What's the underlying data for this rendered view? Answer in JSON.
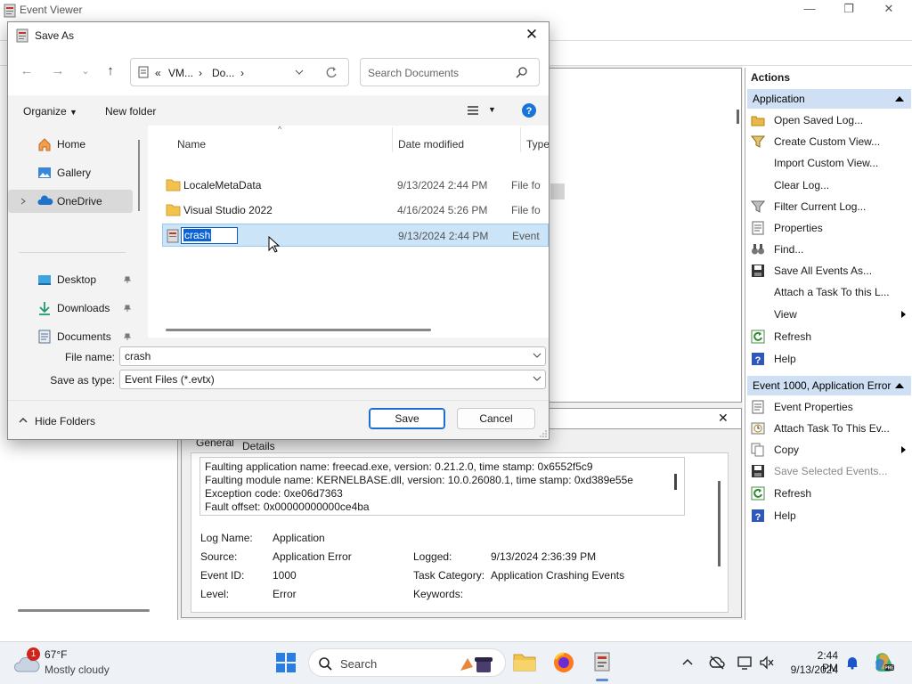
{
  "event_viewer": {
    "title": "Event Viewer",
    "controls": {
      "minimize": "—",
      "maximize": "❐",
      "close": "✕"
    },
    "detail": {
      "tabs": [
        "General",
        "Details"
      ],
      "description": [
        "Faulting application name: freecad.exe, version: 0.21.2.0, time stamp: 0x6552f5c9",
        "Faulting module name: KERNELBASE.dll, version: 10.0.26080.1, time stamp: 0xd389e55e",
        "Exception code: 0xe06d7363",
        "Fault offset: 0x00000000000ce4ba"
      ],
      "fields": {
        "log_name_label": "Log Name:",
        "log_name": "Application",
        "source_label": "Source:",
        "source": "Application Error",
        "logged_label": "Logged:",
        "logged": "9/13/2024 2:36:39 PM",
        "event_id_label": "Event ID:",
        "event_id": "1000",
        "task_category_label": "Task Category:",
        "task_category": "Application Crashing Events",
        "level_label": "Level:",
        "level": "Error",
        "keywords_label": "Keywords:"
      }
    }
  },
  "actions": {
    "header": "Actions",
    "section1": "Application",
    "items1": [
      {
        "label": "Open Saved Log...",
        "icon": "folder-open-icon"
      },
      {
        "label": "Create Custom View...",
        "icon": "filter-icon"
      },
      {
        "label": "Import Custom View...",
        "icon": ""
      },
      {
        "label": "Clear Log...",
        "icon": ""
      },
      {
        "label": "Filter Current Log...",
        "icon": "filter-icon"
      },
      {
        "label": "Properties",
        "icon": "properties-icon"
      },
      {
        "label": "Find...",
        "icon": "binoculars-icon"
      },
      {
        "label": "Save All Events As...",
        "icon": "save-icon"
      },
      {
        "label": "Attach a Task To this L...",
        "icon": ""
      },
      {
        "label": "View",
        "icon": ""
      },
      {
        "label": "Refresh",
        "icon": "refresh-icon"
      },
      {
        "label": "Help",
        "icon": "help-icon"
      }
    ],
    "section2": "Event 1000, Application Error",
    "items2": [
      {
        "label": "Event Properties",
        "icon": "properties-icon"
      },
      {
        "label": "Attach Task To This Ev...",
        "icon": "task-icon"
      },
      {
        "label": "Copy",
        "icon": "copy-icon"
      },
      {
        "label": "Save Selected Events...",
        "icon": "save-icon"
      },
      {
        "label": "Refresh",
        "icon": "refresh-icon"
      },
      {
        "label": "Help",
        "icon": "help-icon"
      }
    ]
  },
  "dialog": {
    "title": "Save As",
    "close": "✕",
    "breadcrumb": {
      "prefix": "«",
      "c1": "VM...",
      "sep1": "›",
      "c2": "Do...",
      "sep2": "›"
    },
    "search_placeholder": "Search Documents",
    "organize": "Organize",
    "new_folder": "New folder",
    "sidebar": [
      {
        "label": "Home",
        "icon": "home-icon"
      },
      {
        "label": "Gallery",
        "icon": "gallery-icon"
      },
      {
        "label": "OneDrive",
        "icon": "onedrive-icon"
      },
      {
        "label": "Desktop",
        "icon": "desktop-icon"
      },
      {
        "label": "Downloads",
        "icon": "downloads-icon"
      },
      {
        "label": "Documents",
        "icon": "documents-icon"
      }
    ],
    "columns": {
      "name": "Name",
      "date": "Date modified",
      "type": "Type"
    },
    "files": [
      {
        "name": "LocaleMetaData",
        "date": "9/13/2024 2:44 PM",
        "type": "File fo"
      },
      {
        "name": "Visual Studio 2022",
        "date": "4/16/2024 5:26 PM",
        "type": "File fo"
      },
      {
        "name": "crash",
        "date": "9/13/2024 2:44 PM",
        "type": "Event"
      }
    ],
    "file_name_label": "File name:",
    "file_name": "crash",
    "save_type_label": "Save as type:",
    "save_type": "Event Files (*.evtx)",
    "hide_folders": "Hide Folders",
    "save": "Save",
    "cancel": "Cancel"
  },
  "taskbar": {
    "weather_badge": "1",
    "temperature": "67°F",
    "condition": "Mostly cloudy",
    "search": "Search",
    "time": "2:44 PM",
    "date": "9/13/2024"
  }
}
